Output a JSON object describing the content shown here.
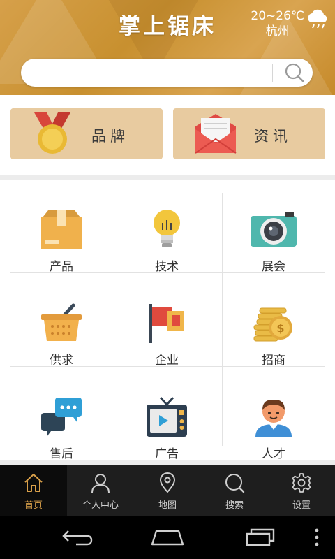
{
  "header": {
    "title": "掌上锯床",
    "weather_temp": "20~26℃",
    "weather_city": "杭州",
    "weather_icon": "cloud-rain-icon"
  },
  "search": {
    "placeholder": "",
    "value": ""
  },
  "cards": [
    {
      "label": "品牌",
      "icon": "medal-icon"
    },
    {
      "label": "资讯",
      "icon": "envelope-icon"
    }
  ],
  "grid": [
    {
      "label": "产品",
      "icon": "box-icon"
    },
    {
      "label": "技术",
      "icon": "lightbulb-icon"
    },
    {
      "label": "展会",
      "icon": "camera-icon"
    },
    {
      "label": "供求",
      "icon": "basket-icon"
    },
    {
      "label": "企业",
      "icon": "flag-icon"
    },
    {
      "label": "招商",
      "icon": "coins-icon"
    },
    {
      "label": "售后",
      "icon": "chat-icon"
    },
    {
      "label": "广告",
      "icon": "tv-icon"
    },
    {
      "label": "人才",
      "icon": "person-icon"
    }
  ],
  "bottom_nav": [
    {
      "label": "首页",
      "icon": "home-icon",
      "active": true
    },
    {
      "label": "个人中心",
      "icon": "user-icon",
      "active": false
    },
    {
      "label": "地图",
      "icon": "map-pin-icon",
      "active": false
    },
    {
      "label": "搜索",
      "icon": "search-icon",
      "active": false
    },
    {
      "label": "设置",
      "icon": "gear-icon",
      "active": false
    }
  ],
  "colors": {
    "header_gold": "#c8902f",
    "card_bg": "#e8cba0",
    "nav_bg": "#1e1e1e",
    "nav_active": "#d9a04a"
  }
}
